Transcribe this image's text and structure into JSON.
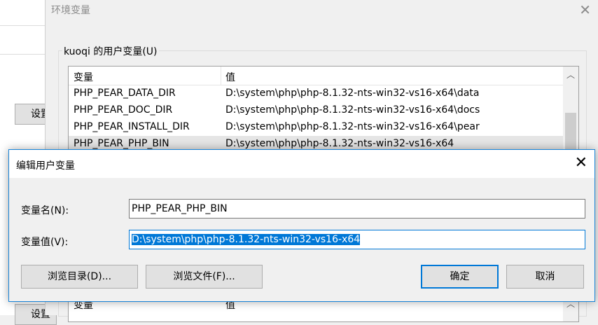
{
  "background_window": {
    "button_label_1": "设置",
    "button_label_2": "设置"
  },
  "env_window": {
    "title": "环境变量",
    "group_label": "kuoqi 的用户变量(U)",
    "list": {
      "header": {
        "name": "变量",
        "value": "值"
      },
      "rows": [
        {
          "name": "PHP_PEAR_DATA_DIR",
          "value": "D:\\system\\php\\php-8.1.32-nts-win32-vs16-x64\\data"
        },
        {
          "name": "PHP_PEAR_DOC_DIR",
          "value": "D:\\system\\php\\php-8.1.32-nts-win32-vs16-x64\\docs"
        },
        {
          "name": "PHP_PEAR_INSTALL_DIR",
          "value": "D:\\system\\php\\php-8.1.32-nts-win32-vs16-x64\\pear"
        },
        {
          "name": "PHP_PEAR_PHP_BIN",
          "value": "D:\\system\\php\\php-8.1.32-nts-win32-vs16-x64"
        }
      ]
    },
    "system_list_header": {
      "name": "变量",
      "value": "值"
    }
  },
  "edit_dialog": {
    "title": "编辑用户变量",
    "name_label": "变量名(N):",
    "name_value": "PHP_PEAR_PHP_BIN",
    "value_label": "变量值(V):",
    "value_value": "D:\\system\\php\\php-8.1.32-nts-win32-vs16-x64",
    "buttons": {
      "browse_dir": "浏览目录(D)...",
      "browse_file": "浏览文件(F)...",
      "ok": "确定",
      "cancel": "取消"
    }
  },
  "colors": {
    "accent": "#0078d7",
    "dialog_border": "#1883d7"
  }
}
